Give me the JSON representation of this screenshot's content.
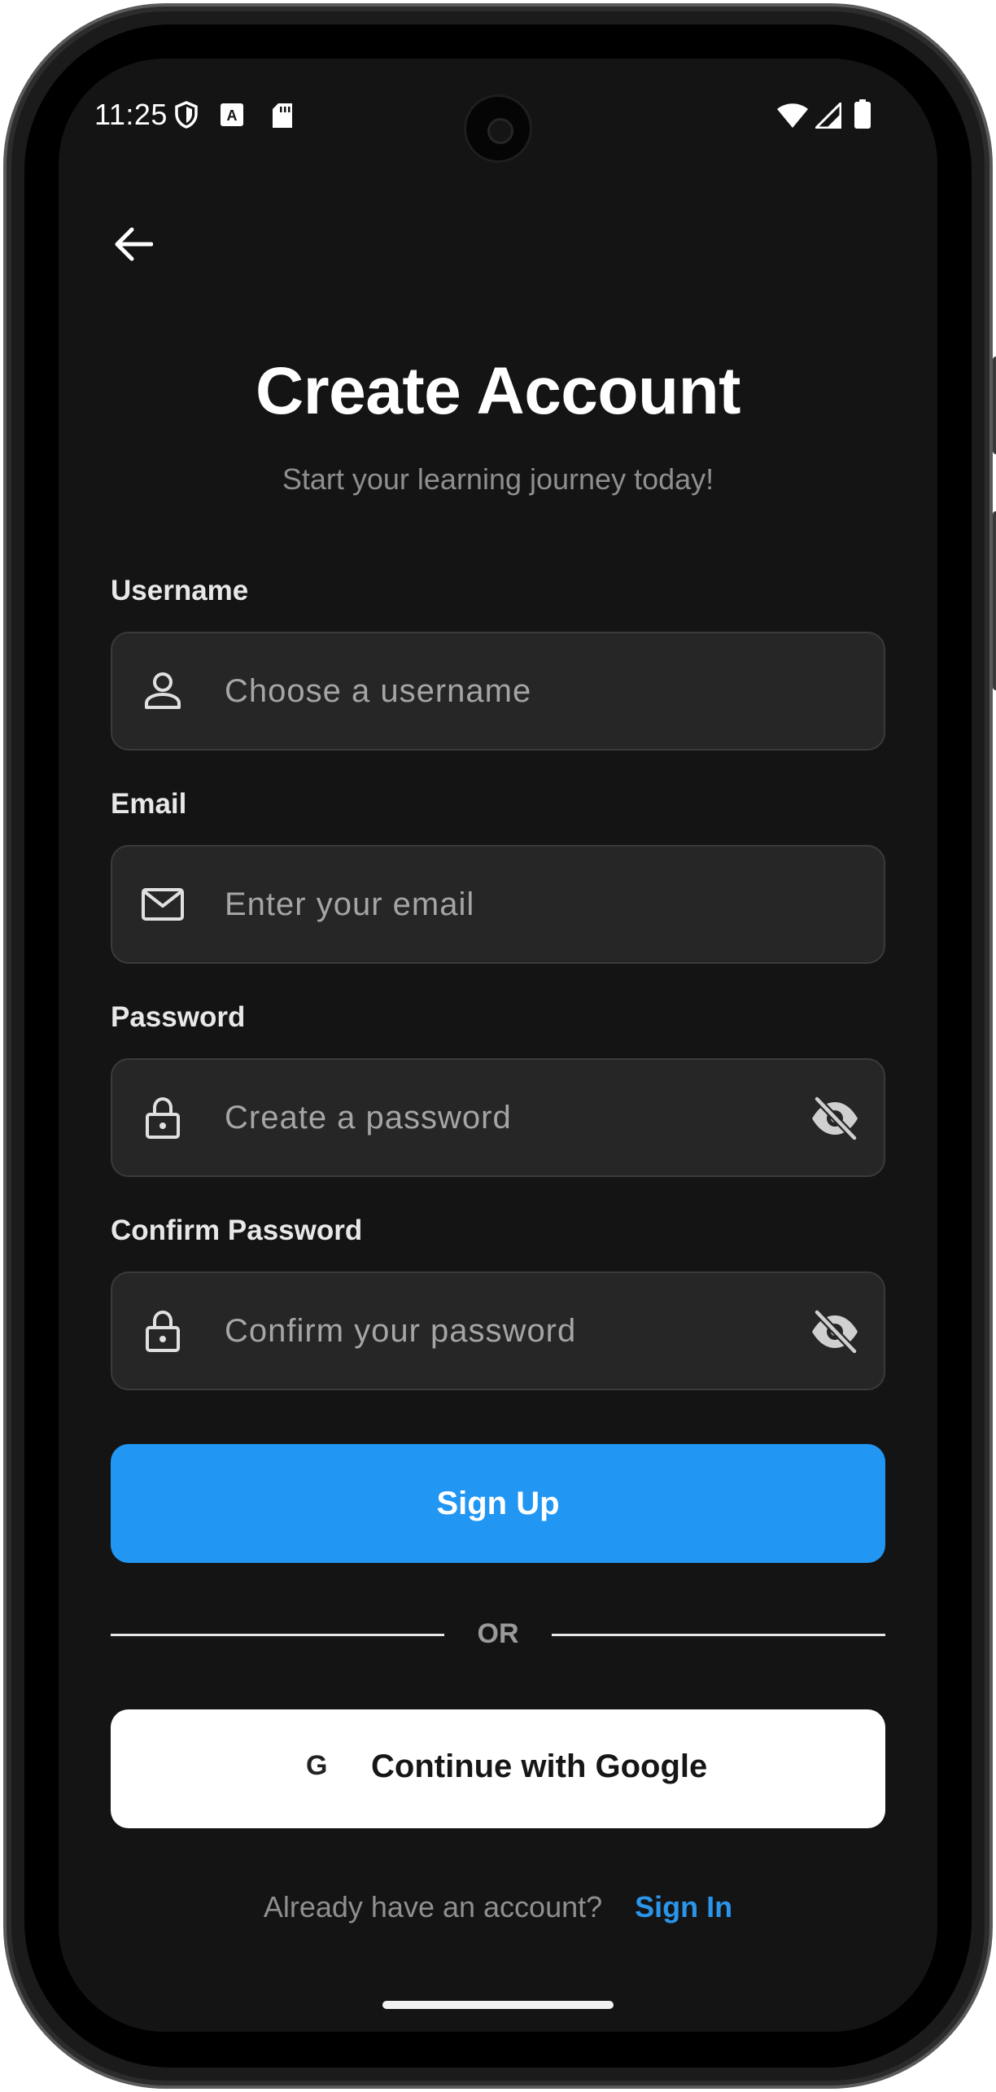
{
  "status_bar": {
    "time": "11:25"
  },
  "header": {
    "title": "Create Account",
    "subtitle": "Start your learning journey today!"
  },
  "form": {
    "username": {
      "label": "Username",
      "placeholder": "Choose a username",
      "icon": "person-icon"
    },
    "email": {
      "label": "Email",
      "placeholder": "Enter your email",
      "icon": "mail-icon"
    },
    "password": {
      "label": "Password",
      "placeholder": "Create a password",
      "icon": "lock-icon",
      "toggle_icon": "eye-off-icon"
    },
    "confirm_password": {
      "label": "Confirm Password",
      "placeholder": "Confirm your password",
      "icon": "lock-icon",
      "toggle_icon": "eye-off-icon"
    }
  },
  "actions": {
    "signup_label": "Sign Up",
    "divider_text": "OR",
    "google_icon_text": "G",
    "google_label": "Continue with Google"
  },
  "footer": {
    "question": "Already have an account?",
    "signin_label": "Sign In"
  },
  "colors": {
    "background": "#141414",
    "field": "#262626",
    "accent": "#2196F3",
    "link": "#2B95EA"
  }
}
